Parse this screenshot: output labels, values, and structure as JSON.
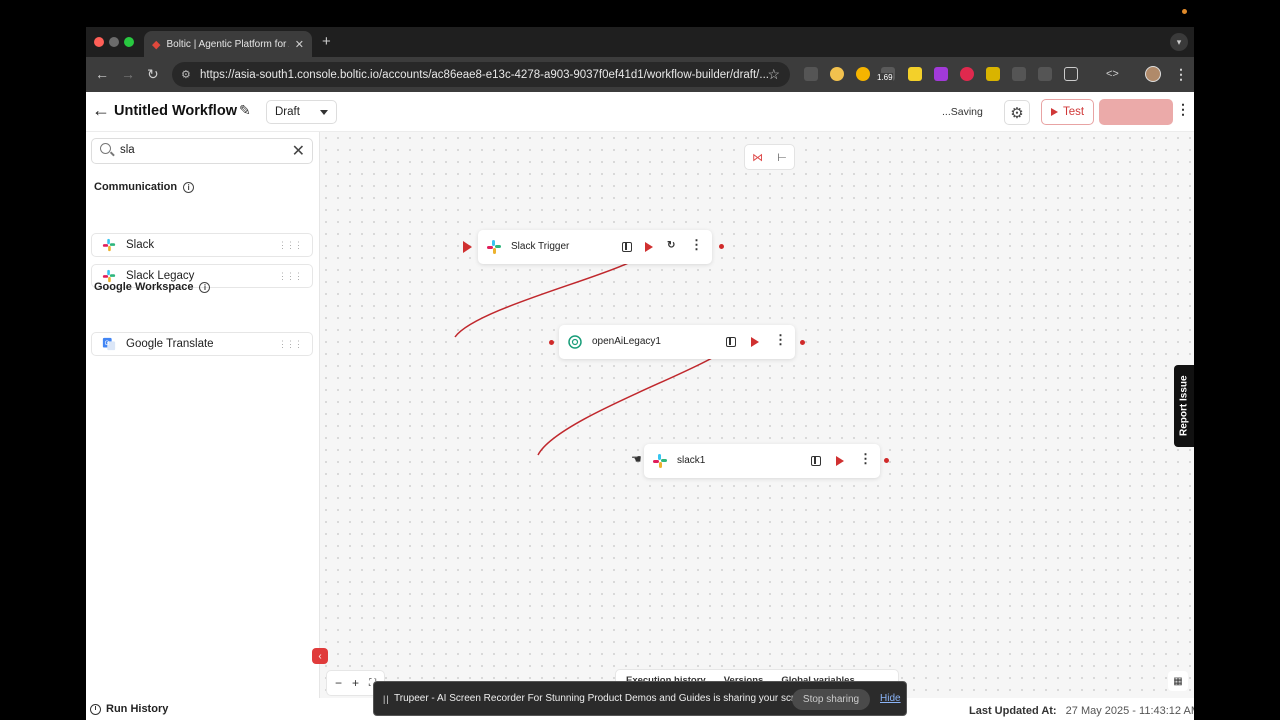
{
  "browser": {
    "tab_title": "Boltic | Agentic Platform for A",
    "url": "https://asia-south1.console.boltic.io/accounts/ac86eae8-e13c-4278-a903-9037f0ef41d1/workflow-builder/draft/...",
    "extension_badge": "1.69"
  },
  "header": {
    "title": "Untitled Workflow",
    "status": "Draft",
    "saving": "...Saving",
    "test_label": "Test"
  },
  "sidebar": {
    "search_value": "sla",
    "sections": [
      {
        "title": "Communication",
        "items": [
          "Slack",
          "Slack Legacy"
        ]
      },
      {
        "title": "Google Workspace",
        "items": [
          "Google Translate"
        ]
      }
    ],
    "run_history": "Run History"
  },
  "canvas": {
    "nodes": [
      {
        "label": "Slack Trigger"
      },
      {
        "label": "openAiLegacy1"
      },
      {
        "label": "slack1"
      }
    ],
    "bottom_tabs": [
      "Execution history",
      "Versions",
      "Global variables"
    ],
    "report_issue": "Report Issue"
  },
  "footer": {
    "last_updated_label": "Last Updated At:",
    "last_updated_value": "27 May 2025 - 11:43:12 AM"
  },
  "share_bar": {
    "message": "Trupeer - AI Screen Recorder For Stunning Product Demos and Guides is sharing your screen.",
    "stop_label": "Stop sharing",
    "hide_label": "Hide"
  },
  "colors": {
    "accent": "#d03030",
    "publish": "#ebaaa9",
    "edge": "#c0282d"
  }
}
